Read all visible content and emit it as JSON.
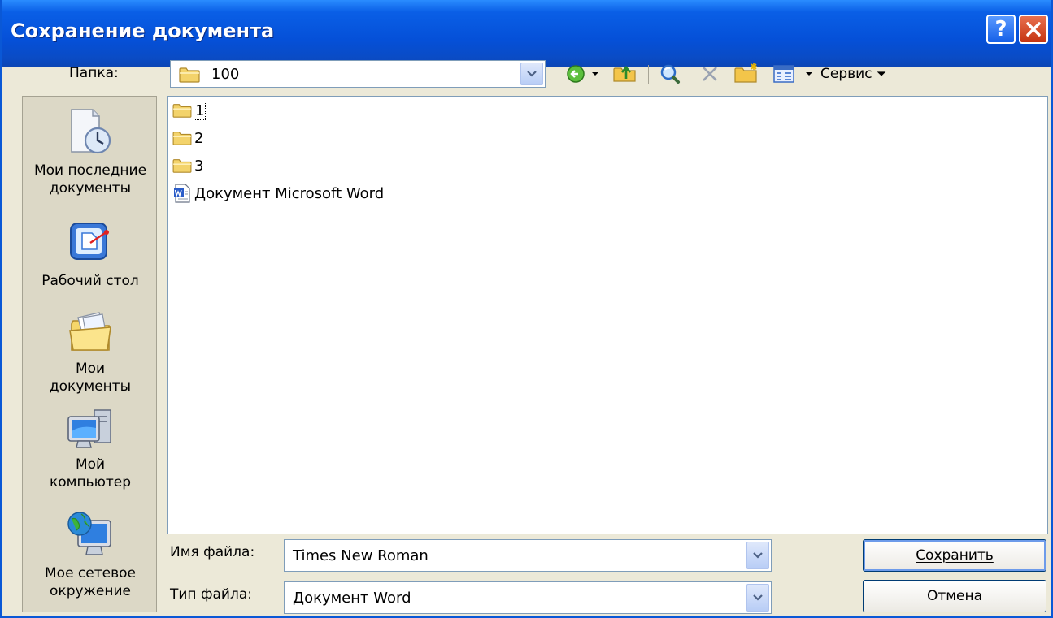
{
  "window": {
    "title": "Сохранение документа",
    "help_icon": "help-icon",
    "close_icon": "close-icon"
  },
  "folder_bar": {
    "label": "Папка:",
    "current_folder": "100",
    "tools_label": "Сервис"
  },
  "places": [
    {
      "icon": "recent-documents-icon",
      "label_line1": "Мои последние",
      "label_line2": "документы"
    },
    {
      "icon": "desktop-icon",
      "label_line1": "Рабочий стол",
      "label_line2": ""
    },
    {
      "icon": "my-documents-icon",
      "label_line1": "Мои",
      "label_line2": "документы"
    },
    {
      "icon": "my-computer-icon",
      "label_line1": "Мой",
      "label_line2": "компьютер"
    },
    {
      "icon": "network-places-icon",
      "label_line1": "Мое сетевое",
      "label_line2": "окружение"
    }
  ],
  "files": [
    {
      "type": "folder",
      "name": "1"
    },
    {
      "type": "folder",
      "name": "2"
    },
    {
      "type": "folder",
      "name": "3"
    },
    {
      "type": "word-document",
      "name": "Документ Microsoft Word"
    }
  ],
  "file_name": {
    "label": "Имя файла:",
    "value": "Times New Roman"
  },
  "file_type": {
    "label": "Тип файла:",
    "value": "Документ Word"
  },
  "buttons": {
    "save": "Сохранить",
    "cancel": "Отмена"
  },
  "colors": {
    "titlebar": "#0550d8",
    "dialog_bg": "#ece9d8",
    "close_button": "#c53411"
  }
}
